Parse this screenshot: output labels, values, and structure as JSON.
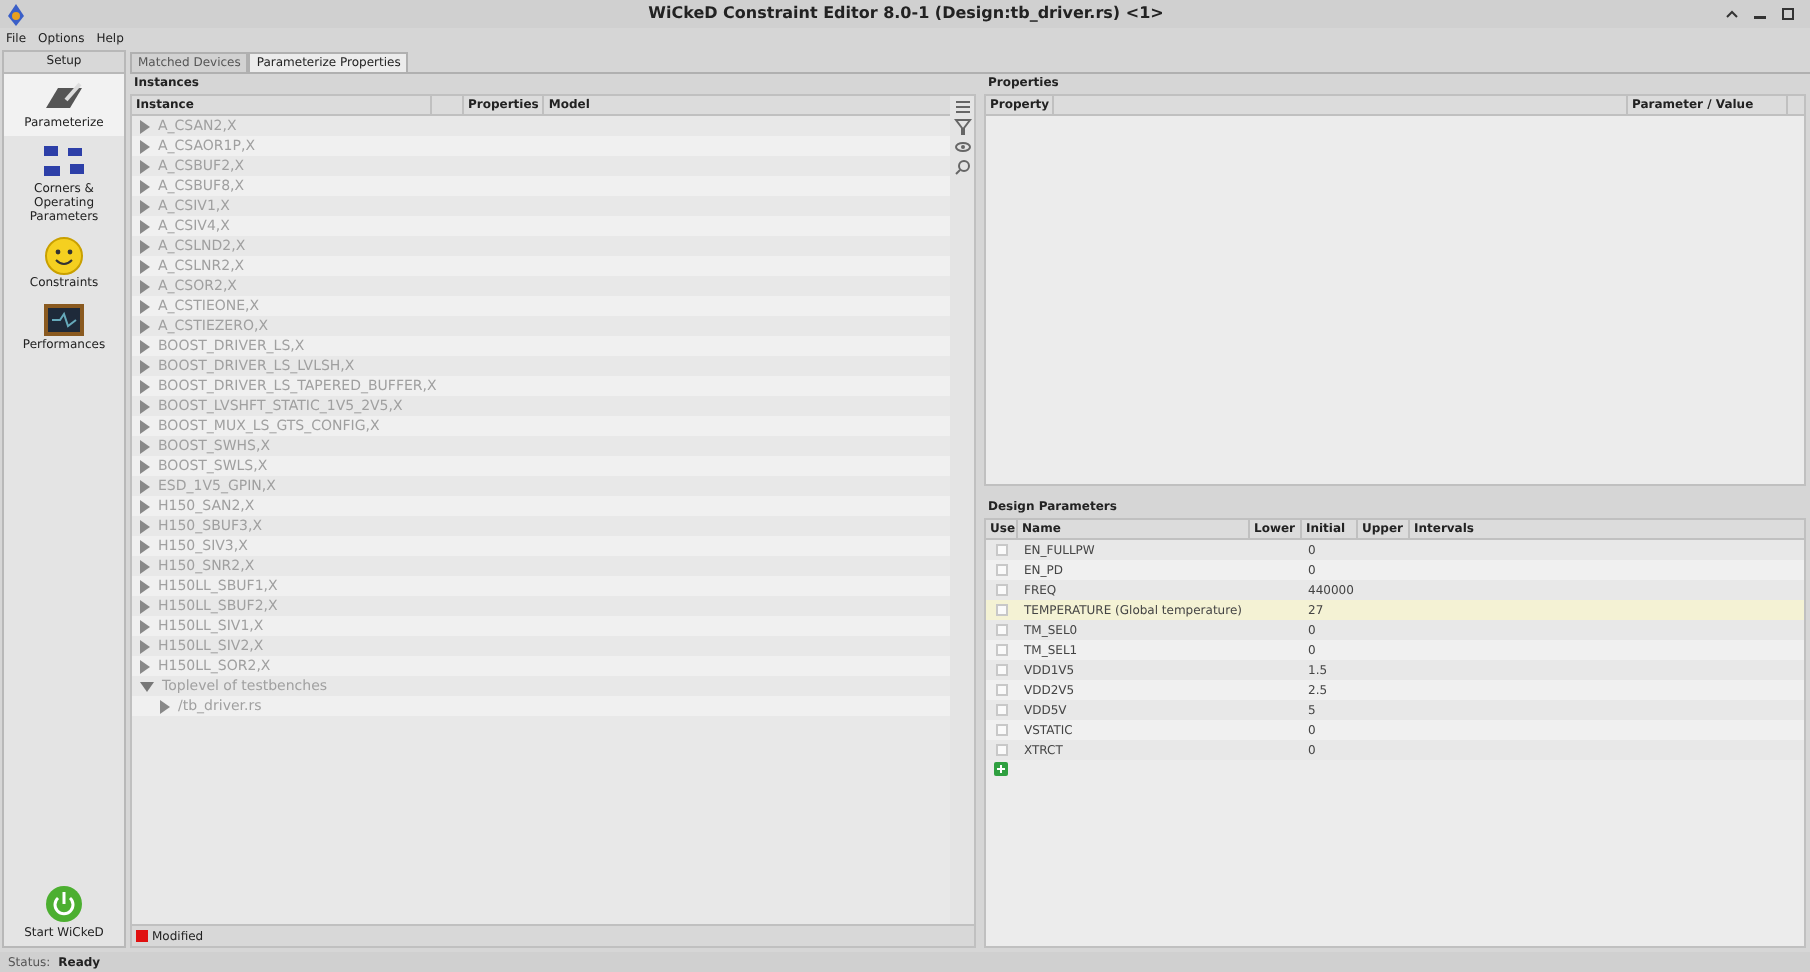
{
  "window": {
    "title": "WiCkeD Constraint Editor 8.0-1 (Design:tb_driver.rs) <1>"
  },
  "menu": [
    "File",
    "Options",
    "Help"
  ],
  "sidebar": {
    "header": "Setup",
    "items": [
      {
        "label": "Parameterize",
        "kind": "parameterize",
        "selected": true
      },
      {
        "label": "Corners & Operating Parameters",
        "kind": "corners",
        "selected": false
      },
      {
        "label": "Constraints",
        "kind": "constraints",
        "selected": false
      },
      {
        "label": "Performances",
        "kind": "performances",
        "selected": false
      }
    ],
    "start": "Start WiCkeD"
  },
  "tabs": [
    {
      "label": "Matched Devices",
      "selected": false
    },
    {
      "label": "Parameterize Properties",
      "selected": true
    }
  ],
  "instances": {
    "title": "Instances",
    "columns": [
      "Instance",
      "Properties",
      "Model"
    ],
    "tree": [
      {
        "label": "A_CSAN2,X",
        "expanded": false
      },
      {
        "label": "A_CSAOR1P,X",
        "expanded": false
      },
      {
        "label": "A_CSBUF2,X",
        "expanded": false
      },
      {
        "label": "A_CSBUF8,X",
        "expanded": false
      },
      {
        "label": "A_CSIV1,X",
        "expanded": false
      },
      {
        "label": "A_CSIV4,X",
        "expanded": false
      },
      {
        "label": "A_CSLND2,X",
        "expanded": false
      },
      {
        "label": "A_CSLNR2,X",
        "expanded": false
      },
      {
        "label": "A_CSOR2,X",
        "expanded": false
      },
      {
        "label": "A_CSTIEONE,X",
        "expanded": false
      },
      {
        "label": "A_CSTIEZERO,X",
        "expanded": false
      },
      {
        "label": "BOOST_DRIVER_LS,X",
        "expanded": false
      },
      {
        "label": "BOOST_DRIVER_LS_LVLSH,X",
        "expanded": false
      },
      {
        "label": "BOOST_DRIVER_LS_TAPERED_BUFFER,X",
        "expanded": false
      },
      {
        "label": "BOOST_LVSHFT_STATIC_1V5_2V5,X",
        "expanded": false
      },
      {
        "label": "BOOST_MUX_LS_GTS_CONFIG,X",
        "expanded": false
      },
      {
        "label": "BOOST_SWHS,X",
        "expanded": false
      },
      {
        "label": "BOOST_SWLS,X",
        "expanded": false
      },
      {
        "label": "ESD_1V5_GPIN,X",
        "expanded": false
      },
      {
        "label": "H150_SAN2,X",
        "expanded": false
      },
      {
        "label": "H150_SBUF3,X",
        "expanded": false
      },
      {
        "label": "H150_SIV3,X",
        "expanded": false
      },
      {
        "label": "H150_SNR2,X",
        "expanded": false
      },
      {
        "label": "H150LL_SBUF1,X",
        "expanded": false
      },
      {
        "label": "H150LL_SBUF2,X",
        "expanded": false
      },
      {
        "label": "H150LL_SIV1,X",
        "expanded": false
      },
      {
        "label": "H150LL_SIV2,X",
        "expanded": false
      },
      {
        "label": "H150LL_SOR2,X",
        "expanded": false
      },
      {
        "label": "Toplevel of testbenches",
        "expanded": true,
        "children": [
          {
            "label": "/tb_driver.rs",
            "expanded": false
          }
        ]
      }
    ],
    "status": "Modified"
  },
  "properties": {
    "title": "Properties",
    "columns": [
      "Property",
      "Parameter / Value"
    ]
  },
  "design_parameters": {
    "title": "Design Parameters",
    "columns": [
      "Use",
      "Name",
      "Lower",
      "Initial",
      "Upper",
      "Intervals"
    ],
    "rows": [
      {
        "use": false,
        "name": "EN_FULLPW",
        "initial": "0",
        "selected": false
      },
      {
        "use": false,
        "name": "EN_PD",
        "initial": "0",
        "selected": false
      },
      {
        "use": false,
        "name": "FREQ",
        "initial": "440000",
        "selected": false
      },
      {
        "use": false,
        "name": "TEMPERATURE (Global temperature)",
        "initial": "27",
        "selected": true
      },
      {
        "use": false,
        "name": "TM_SEL0",
        "initial": "0",
        "selected": false
      },
      {
        "use": false,
        "name": "TM_SEL1",
        "initial": "0",
        "selected": false
      },
      {
        "use": false,
        "name": "VDD1V5",
        "initial": "1.5",
        "selected": false
      },
      {
        "use": false,
        "name": "VDD2V5",
        "initial": "2.5",
        "selected": false
      },
      {
        "use": false,
        "name": "VDD5V",
        "initial": "5",
        "selected": false
      },
      {
        "use": false,
        "name": "VSTATIC",
        "initial": "0",
        "selected": false
      },
      {
        "use": false,
        "name": "XTRCT",
        "initial": "0",
        "selected": false
      }
    ]
  },
  "status_bar": {
    "label": "Status:",
    "value": "Ready"
  }
}
